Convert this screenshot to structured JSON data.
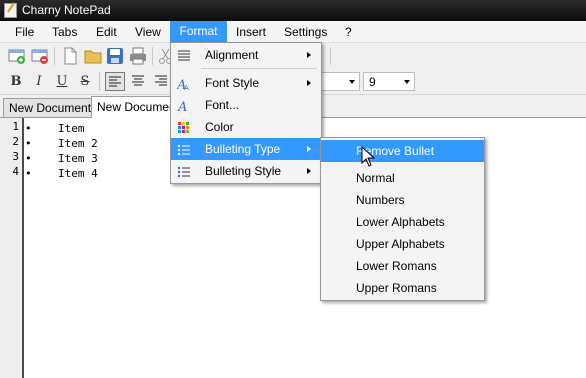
{
  "window": {
    "title": "Charny NotePad"
  },
  "menubar": {
    "items": [
      {
        "label": "File"
      },
      {
        "label": "Tabs"
      },
      {
        "label": "Edit"
      },
      {
        "label": "View"
      },
      {
        "label": "Format"
      },
      {
        "label": "Insert"
      },
      {
        "label": "Settings"
      },
      {
        "label": "?"
      }
    ],
    "active": "Format"
  },
  "format_toolbar": {
    "bold": "B",
    "italic": "I",
    "underline": "U",
    "strikethrough": "S",
    "font_size": "9"
  },
  "tabs": [
    {
      "label": "New Document*"
    },
    {
      "label": "New Document"
    }
  ],
  "editor": {
    "line_numbers": [
      "1",
      "2",
      "3",
      "4"
    ],
    "lines": [
      "Item",
      "Item 2",
      "Item 3",
      "Item 4"
    ],
    "bullet": "•"
  },
  "format_menu": {
    "items": [
      {
        "label": "Alignment",
        "icon": "align-icon",
        "submenu": true
      },
      {
        "label": "Font Style",
        "icon": "font-style-icon",
        "submenu": true
      },
      {
        "label": "Font...",
        "icon": "font-icon",
        "submenu": false
      },
      {
        "label": "Color",
        "icon": "color-icon",
        "submenu": false
      },
      {
        "label": "Bulleting Type",
        "icon": "bullet-type-icon",
        "submenu": true,
        "highlighted": true
      },
      {
        "label": "Bulleting Style",
        "icon": "bullet-style-icon",
        "submenu": true
      }
    ]
  },
  "bulleting_type_menu": {
    "items": [
      {
        "label": "Remove Bullet",
        "highlighted": true
      },
      {
        "label": "Normal"
      },
      {
        "label": "Numbers"
      },
      {
        "label": "Lower Alphabets"
      },
      {
        "label": "Upper Alphabets"
      },
      {
        "label": "Lower Romans"
      },
      {
        "label": "Upper Romans"
      }
    ]
  },
  "colors": {
    "highlight": "#3399ff",
    "titlebar": "#1a1a1a"
  }
}
